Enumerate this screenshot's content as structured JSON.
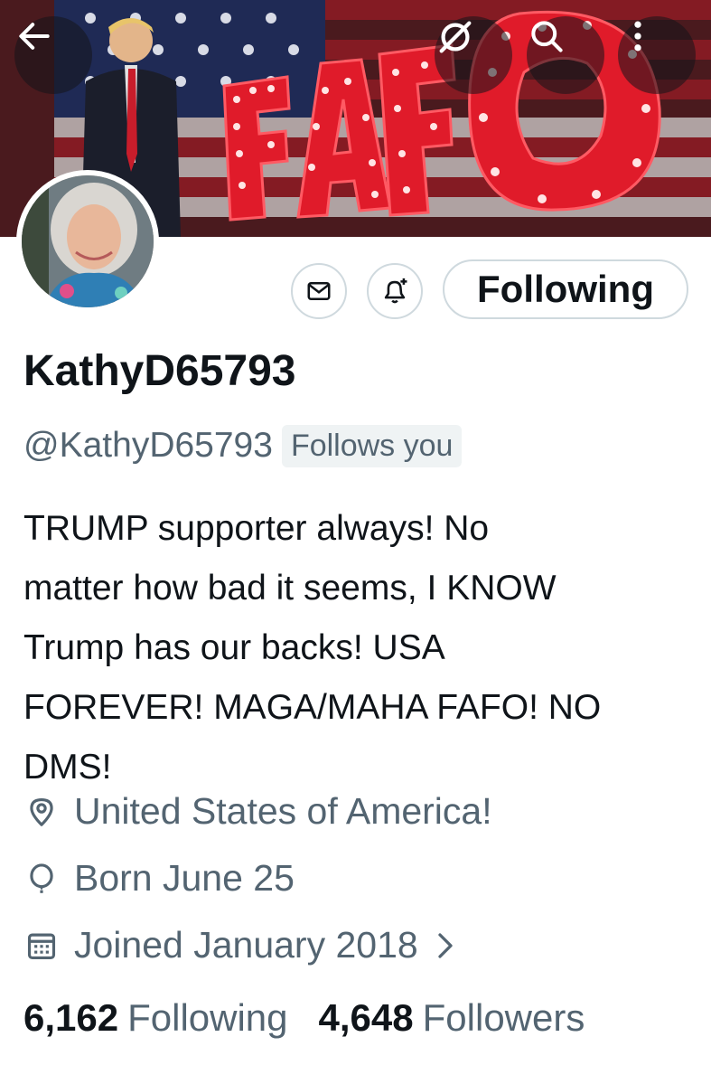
{
  "banner": {
    "text": "FAFO",
    "colors": {
      "letters": "#e01b2a",
      "bulbs": "#ffd7d7",
      "flag_blue": "#1f2a55",
      "flag_stripe": "#c9c4c4"
    }
  },
  "header": {
    "back_icon": "arrow-left-icon",
    "grok_icon": "grok-icon",
    "search_icon": "search-icon",
    "more_icon": "more-vertical-icon"
  },
  "actions": {
    "message_icon": "envelope-icon",
    "notify_icon": "bell-plus-icon",
    "follow_label": "Following"
  },
  "profile": {
    "display_name": "KathyD65793",
    "handle": "@KathyD65793",
    "follows_you": "Follows you",
    "bio_lines": [
      "TRUMP supporter always! No",
      "matter how bad it seems, I KNOW",
      "Trump has our backs!  USA",
      "FOREVER! MAGA/MAHA FAFO! NO",
      "DMS!"
    ],
    "location": "United States of America!",
    "birthday": "Born June 25",
    "joined": "Joined January 2018",
    "following_count": "6,162",
    "following_label": "Following",
    "followers_count": "4,648",
    "followers_label": "Followers"
  },
  "colors": {
    "text_primary": "#0f1419",
    "text_secondary": "#536471",
    "border": "#cfd9de"
  }
}
